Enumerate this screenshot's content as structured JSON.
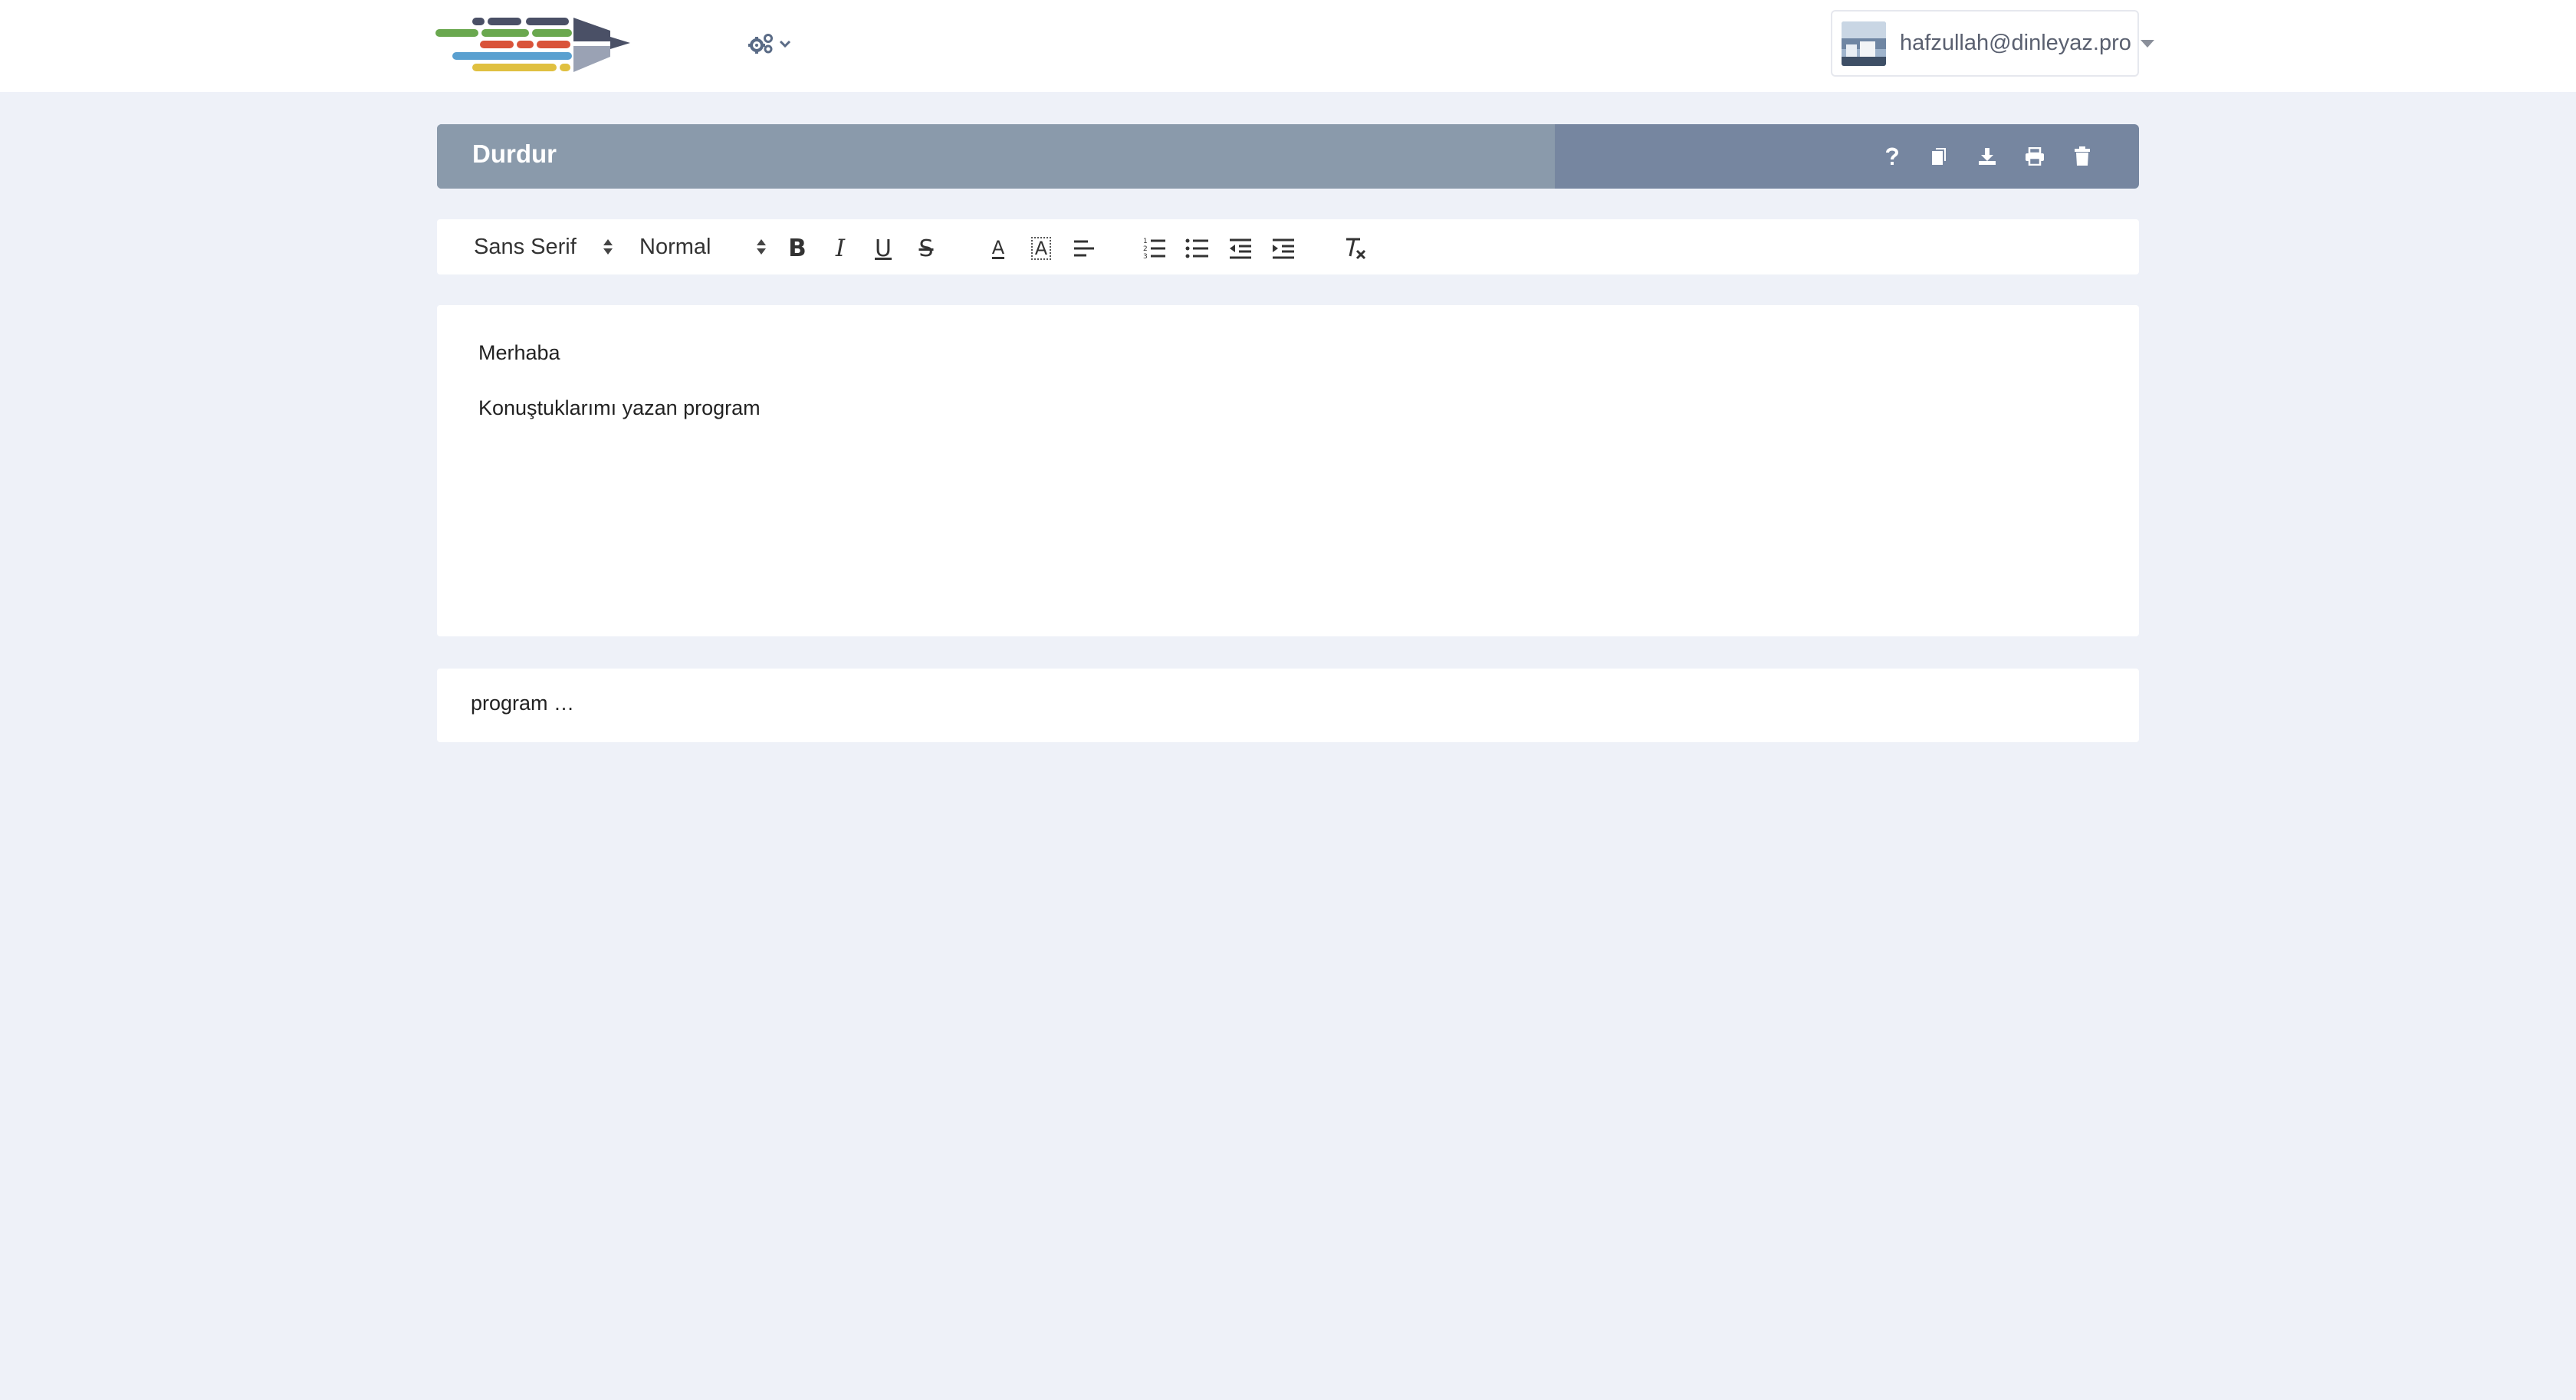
{
  "topbar": {
    "logo_icon": "dinleyaz-logo",
    "settings_icon": "gears-icon",
    "settings_chevron_icon": "chevron-down-icon",
    "user": {
      "avatar": "avatar-photo",
      "email": "hafzullah@dinleyaz.pro"
    }
  },
  "header": {
    "title": "Durdur",
    "actions": [
      {
        "icon": "question-icon",
        "label": "?"
      },
      {
        "icon": "copy-icon"
      },
      {
        "icon": "download-icon"
      },
      {
        "icon": "print-icon"
      },
      {
        "icon": "trash-icon"
      }
    ]
  },
  "toolbar": {
    "font_family": "Sans Serif",
    "font_size": "Normal",
    "buttons": [
      "bold",
      "italic",
      "underline",
      "strike",
      "text-color",
      "background-color",
      "align",
      "ordered-list",
      "bullet-list",
      "outdent",
      "indent",
      "clean-format"
    ],
    "bold_label": "B",
    "italic_label": "I",
    "underline_label": "U",
    "strike_label": "S",
    "color_label": "A"
  },
  "editor": {
    "paragraphs": [
      "Merhaba",
      "Konuştuklarımı yazan program"
    ]
  },
  "transcript": {
    "text": "program …"
  },
  "colors": {
    "page_bg": "#eef1f8",
    "header_left": "#8a9aab",
    "header_right": "#7686a0"
  }
}
